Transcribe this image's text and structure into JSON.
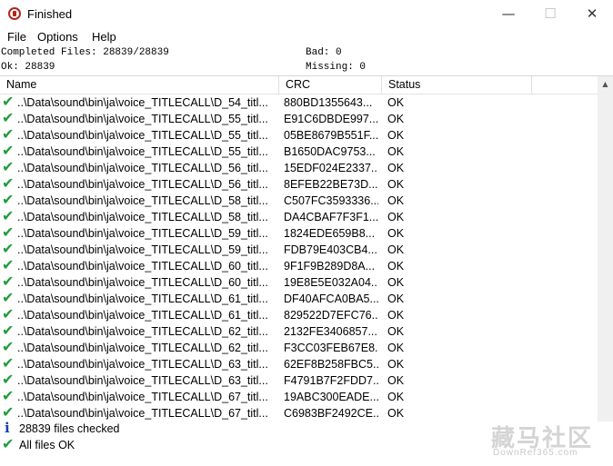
{
  "window": {
    "title": "Finished",
    "min_glyph": "—",
    "max_glyph": "☐",
    "close_glyph": "✕",
    "icon": "app-lifebuoy-icon"
  },
  "menu": [
    "File",
    "Options",
    "Help"
  ],
  "stats": {
    "completed": "Completed Files: 28839/28839",
    "bad": "Bad: 0",
    "ok": "Ok: 28839",
    "missing": "Missing: 0"
  },
  "columns": {
    "name": "Name",
    "crc": "CRC",
    "status": "Status"
  },
  "scroll_up_glyph": "▲",
  "row_icon": "green-check-icon",
  "check_glyph": "✔",
  "rows": [
    {
      "name": "..\\Data\\sound\\bin\\ja\\voice_TITLECALL\\D_54_titl...",
      "crc": "880BD1355643...",
      "status": "OK"
    },
    {
      "name": "..\\Data\\sound\\bin\\ja\\voice_TITLECALL\\D_55_titl...",
      "crc": "E91C6DBDE997...",
      "status": "OK"
    },
    {
      "name": "..\\Data\\sound\\bin\\ja\\voice_TITLECALL\\D_55_titl...",
      "crc": "05BE8679B551F...",
      "status": "OK"
    },
    {
      "name": "..\\Data\\sound\\bin\\ja\\voice_TITLECALL\\D_55_titl...",
      "crc": "B1650DAC9753...",
      "status": "OK"
    },
    {
      "name": "..\\Data\\sound\\bin\\ja\\voice_TITLECALL\\D_56_titl...",
      "crc": "15EDF024E2337...",
      "status": "OK"
    },
    {
      "name": "..\\Data\\sound\\bin\\ja\\voice_TITLECALL\\D_56_titl...",
      "crc": "8EFEB22BE73D...",
      "status": "OK"
    },
    {
      "name": "..\\Data\\sound\\bin\\ja\\voice_TITLECALL\\D_58_titl...",
      "crc": "C507FC3593336...",
      "status": "OK"
    },
    {
      "name": "..\\Data\\sound\\bin\\ja\\voice_TITLECALL\\D_58_titl...",
      "crc": "DA4CBAF7F3F1...",
      "status": "OK"
    },
    {
      "name": "..\\Data\\sound\\bin\\ja\\voice_TITLECALL\\D_59_titl...",
      "crc": "1824EDE659B8...",
      "status": "OK"
    },
    {
      "name": "..\\Data\\sound\\bin\\ja\\voice_TITLECALL\\D_59_titl...",
      "crc": "FDB79E403CB4...",
      "status": "OK"
    },
    {
      "name": "..\\Data\\sound\\bin\\ja\\voice_TITLECALL\\D_60_titl...",
      "crc": "9F1F9B289D8A...",
      "status": "OK"
    },
    {
      "name": "..\\Data\\sound\\bin\\ja\\voice_TITLECALL\\D_60_titl...",
      "crc": "19E8E5E032A04...",
      "status": "OK"
    },
    {
      "name": "..\\Data\\sound\\bin\\ja\\voice_TITLECALL\\D_61_titl...",
      "crc": "DF40AFCA0BA5...",
      "status": "OK"
    },
    {
      "name": "..\\Data\\sound\\bin\\ja\\voice_TITLECALL\\D_61_titl...",
      "crc": "829522D7EFC76...",
      "status": "OK"
    },
    {
      "name": "..\\Data\\sound\\bin\\ja\\voice_TITLECALL\\D_62_titl...",
      "crc": "2132FE3406857...",
      "status": "OK"
    },
    {
      "name": "..\\Data\\sound\\bin\\ja\\voice_TITLECALL\\D_62_titl...",
      "crc": "F3CC03FEB67E8...",
      "status": "OK"
    },
    {
      "name": "..\\Data\\sound\\bin\\ja\\voice_TITLECALL\\D_63_titl...",
      "crc": "62EF8B258FBC5...",
      "status": "OK"
    },
    {
      "name": "..\\Data\\sound\\bin\\ja\\voice_TITLECALL\\D_63_titl...",
      "crc": "F4791B7F2FDD7...",
      "status": "OK"
    },
    {
      "name": "..\\Data\\sound\\bin\\ja\\voice_TITLECALL\\D_67_titl...",
      "crc": "19ABC300EADE...",
      "status": "OK"
    },
    {
      "name": "..\\Data\\sound\\bin\\ja\\voice_TITLECALL\\D_67_titl...",
      "crc": "C6983BF2492CE...",
      "status": "OK"
    }
  ],
  "footer": {
    "checked": "28839 files checked",
    "all_ok": "All files OK",
    "info_glyph": "i"
  },
  "watermark": {
    "main": "藏马社区",
    "sub": "DownRef365.com"
  },
  "colors": {
    "check": "#1f9d3a",
    "info": "#1b3ea8",
    "app_icon": "#b3261e"
  }
}
